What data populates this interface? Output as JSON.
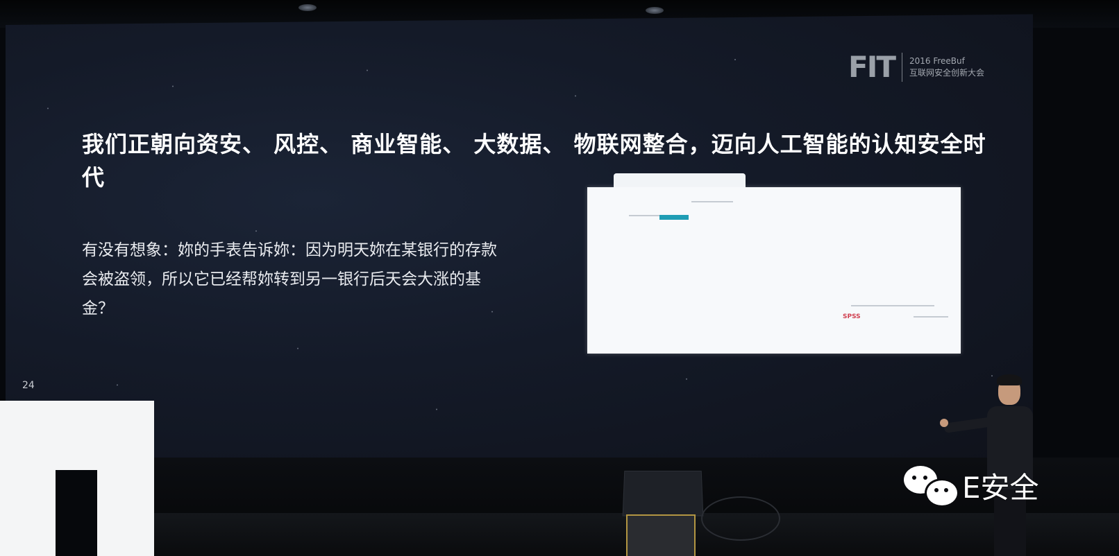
{
  "slide": {
    "title": "我们正朝向资安、 风控、 商业智能、 大数据、 物联网整合，迈向人工智能的认知安全时代",
    "body": "有没有想象：妳的手表告诉妳：因为明天妳在某银行的存款会被盗领，所以它已经帮妳转到另一银行后天会大涨的基金？",
    "page_number": "24"
  },
  "logo": {
    "mark": "FIT",
    "line1": "2016 FreeBuf",
    "line2": "互联网安全创新大会"
  },
  "embedded_screenshot": {
    "brand": "SPSS"
  },
  "watermark": {
    "icon": "wechat-icon",
    "text": "E安全"
  },
  "colors": {
    "slide_background": "#141a28",
    "title_text": "#ffffff",
    "stage_letters": "#f4f5f6"
  }
}
